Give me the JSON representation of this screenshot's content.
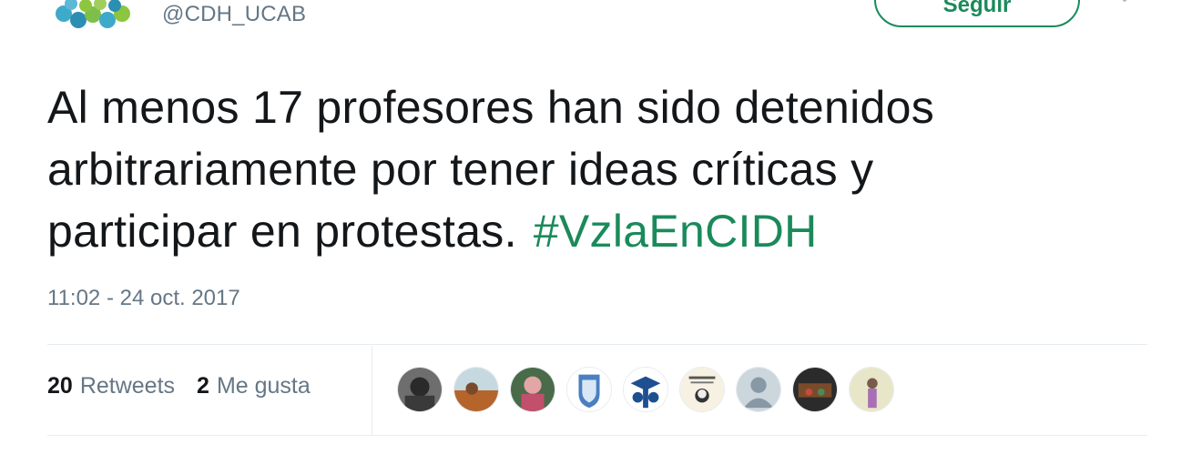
{
  "account": {
    "handle": "@CDH_UCAB",
    "avatar_icon": "ucab-logo-icon"
  },
  "actions": {
    "follow_label": "Seguir"
  },
  "tweet": {
    "text_lines": [
      "Al menos 17 profesores han sido detenidos",
      "arbitrariamente por tener ideas críticas y",
      "participar en protestas."
    ],
    "hashtag": "#VzlaEnCIDH",
    "timestamp": "11:02 - 24 oct. 2017"
  },
  "stats": {
    "retweets_count": "20",
    "retweets_label": "Retweets",
    "likes_count": "2",
    "likes_label": "Me gusta"
  },
  "likers_count_shown": 9,
  "colors": {
    "accent": "#1b8a5a",
    "secondary_text": "#657786",
    "divider": "#e6ecf0"
  }
}
